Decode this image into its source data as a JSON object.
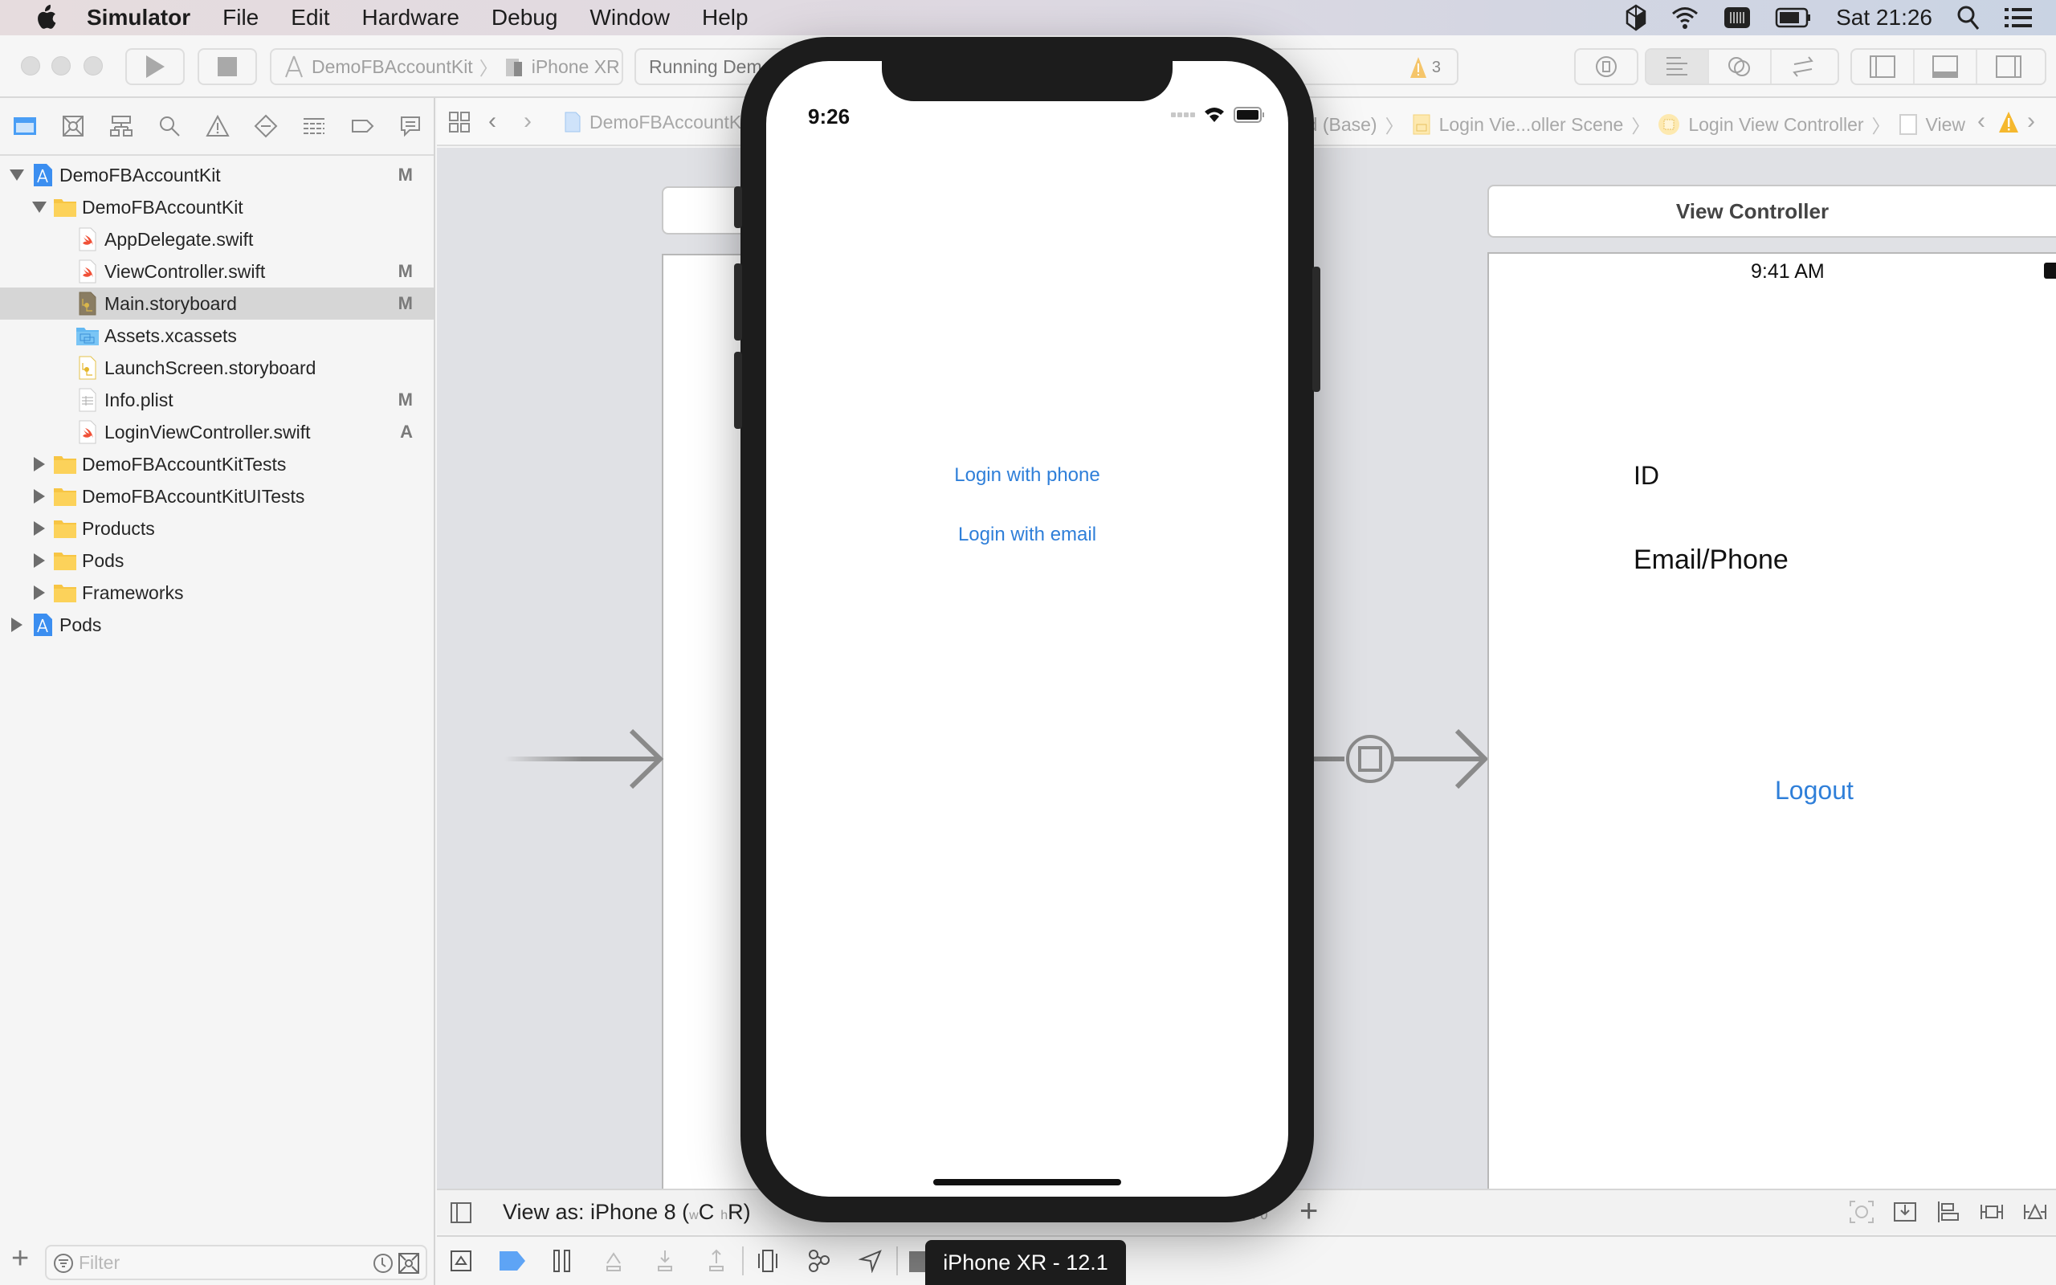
{
  "menubar": {
    "app_name": "Simulator",
    "items": [
      "File",
      "Edit",
      "Hardware",
      "Debug",
      "Window",
      "Help"
    ],
    "clock": "Sat 21:26",
    "status_icons": [
      "virtualbox-icon",
      "wifi-icon",
      "keyboard-icon",
      "battery-icon",
      "spotlight-icon",
      "notification-center-icon"
    ]
  },
  "toolbar": {
    "scheme_project": "DemoFBAccountKit",
    "scheme_device": "iPhone XR",
    "activity_text": "Running Dem",
    "warning_count": "3"
  },
  "navigator": {
    "tabs": [
      "project-navigator",
      "source-control-navigator",
      "symbol-navigator",
      "find-navigator",
      "issue-navigator",
      "test-navigator",
      "debug-navigator",
      "breakpoint-navigator",
      "report-navigator"
    ],
    "tree": [
      {
        "label": "DemoFBAccountKit",
        "type": "project",
        "level": 0,
        "expanded": true,
        "badge": "M"
      },
      {
        "label": "DemoFBAccountKit",
        "type": "folder",
        "level": 1,
        "expanded": true,
        "badge": ""
      },
      {
        "label": "AppDelegate.swift",
        "type": "swift",
        "level": 2,
        "badge": ""
      },
      {
        "label": "ViewController.swift",
        "type": "swift",
        "level": 2,
        "badge": "M"
      },
      {
        "label": "Main.storyboard",
        "type": "storyboard",
        "level": 2,
        "badge": "M",
        "selected": true
      },
      {
        "label": "Assets.xcassets",
        "type": "assets",
        "level": 2,
        "badge": ""
      },
      {
        "label": "LaunchScreen.storyboard",
        "type": "storyboard-yellow",
        "level": 2,
        "badge": ""
      },
      {
        "label": "Info.plist",
        "type": "plist",
        "level": 2,
        "badge": "M"
      },
      {
        "label": "LoginViewController.swift",
        "type": "swift",
        "level": 2,
        "badge": "A"
      },
      {
        "label": "DemoFBAccountKitTests",
        "type": "folder",
        "level": 1,
        "expanded": false,
        "badge": ""
      },
      {
        "label": "DemoFBAccountKitUITests",
        "type": "folder",
        "level": 1,
        "expanded": false,
        "badge": ""
      },
      {
        "label": "Products",
        "type": "folder",
        "level": 1,
        "expanded": false,
        "badge": ""
      },
      {
        "label": "Pods",
        "type": "folder",
        "level": 1,
        "expanded": false,
        "badge": ""
      },
      {
        "label": "Frameworks",
        "type": "folder",
        "level": 1,
        "expanded": false,
        "badge": ""
      },
      {
        "label": "Pods",
        "type": "project",
        "level": 0,
        "expanded": false,
        "badge": ""
      }
    ],
    "filter_placeholder": "Filter"
  },
  "jumpbar": {
    "left_crumb": "DemoFBAccountK",
    "crumbs_right": [
      "rd (Base)",
      "Login Vie...oller Scene",
      "Login View Controller",
      "View"
    ]
  },
  "canvas": {
    "scene_title": "View Controller",
    "scene_status_time": "9:41 AM",
    "labels": [
      "ID",
      "Email/Phone"
    ],
    "logout_button": "Logout"
  },
  "ib_footer": {
    "view_as_prefix": "View as: iPhone 8 (",
    "size_w": "w",
    "size_w_val": "C",
    "size_h": "h",
    "size_h_val": "R",
    "suffix": ")",
    "zoom": "100%"
  },
  "simulator": {
    "time": "9:26",
    "buttons": [
      "Login with phone",
      "Login with email"
    ]
  },
  "tooltip": "iPhone XR - 12.1",
  "colors": {
    "ios_tint": "#2f7fd9",
    "selection": "#d6d6d6",
    "warning": "#f5b82e"
  }
}
